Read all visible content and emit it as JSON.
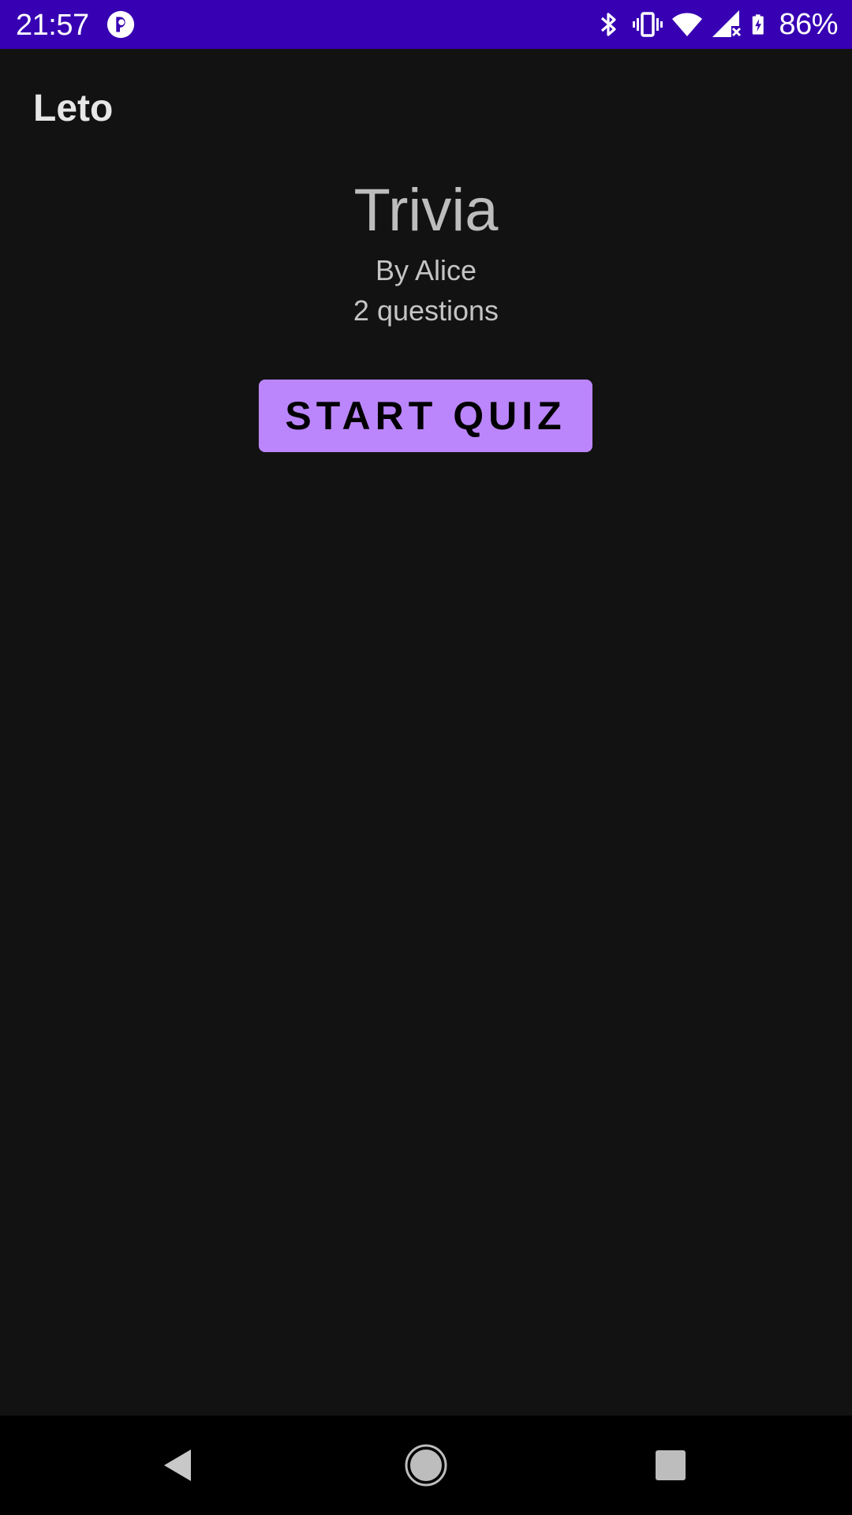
{
  "status_bar": {
    "time": "21:57",
    "battery": "86%",
    "icons": [
      "app-notification-icon",
      "bluetooth-icon",
      "vibrate-icon",
      "wifi-icon",
      "cell-signal-icon",
      "battery-charging-icon"
    ],
    "background_color": "#3700b3"
  },
  "app_bar": {
    "title": "Leto"
  },
  "quiz": {
    "title": "Trivia",
    "author": "By Alice",
    "question_count": "2 questions",
    "start_label": "START QUIZ",
    "accent_color": "#bb86fc"
  },
  "nav_bar": {
    "icons": [
      "back-icon",
      "home-icon",
      "recents-icon"
    ]
  },
  "theme": {
    "background": "#121212"
  }
}
